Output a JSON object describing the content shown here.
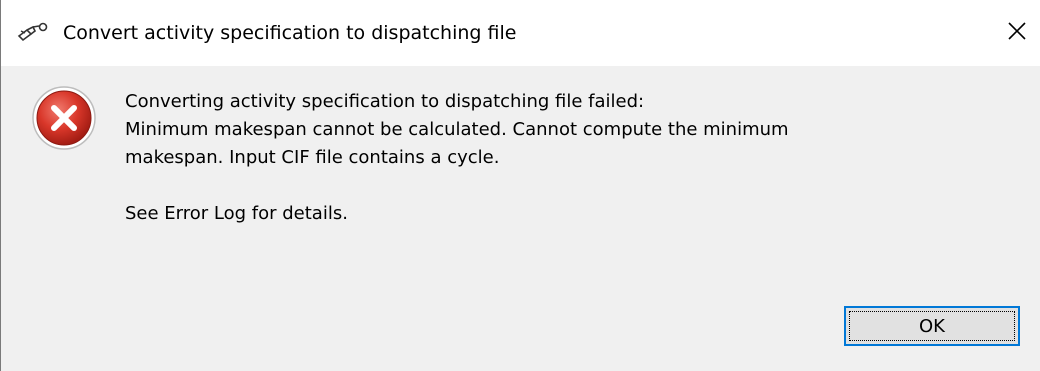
{
  "window": {
    "title": "Convert activity specification to dispatching file",
    "app_icon": "tool-icon",
    "close_icon": "close-icon"
  },
  "message": {
    "icon": "error-icon",
    "lines": [
      "Converting activity specification to dispatching file failed:",
      "Minimum makespan cannot be calculated. Cannot compute the minimum",
      "makespan. Input CIF file contains a cycle."
    ],
    "footer": "See Error Log for details."
  },
  "buttons": {
    "ok_label": "OK"
  },
  "colors": {
    "error_red": "#c42b1c",
    "focus_blue": "#0078d7",
    "dialog_bg": "#f0f0f0"
  }
}
